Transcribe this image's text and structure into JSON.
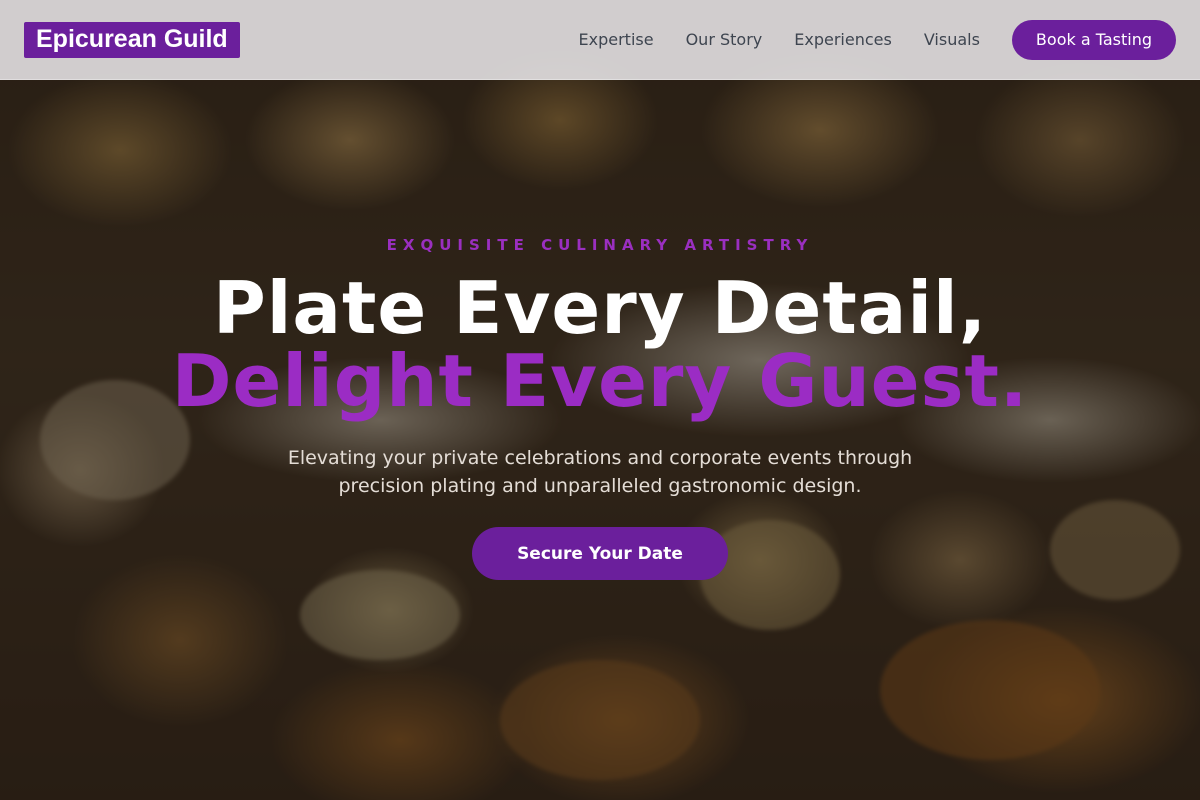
{
  "navbar": {
    "brand": "Epicurean Guild",
    "links": [
      "Expertise",
      "Our Story",
      "Experiences",
      "Visuals"
    ],
    "cta_label": "Book a Tasting"
  },
  "hero": {
    "eyebrow": "EXQUISITE CULINARY ARTISTRY",
    "headline_line1": "Plate Every Detail,",
    "headline_line2": "Delight Every Guest.",
    "subtext": "Elevating your private celebrations and corporate events through precision plating and unparalleled gastronomic design.",
    "cta_label": "Secure Your Date",
    "background_image": "food-platter-photo"
  },
  "colors": {
    "accent": "#6b1f9c",
    "accent_text": "#9b2cc4",
    "nav_text": "#3e4550",
    "navbar_bg": "#e8e6e8"
  }
}
